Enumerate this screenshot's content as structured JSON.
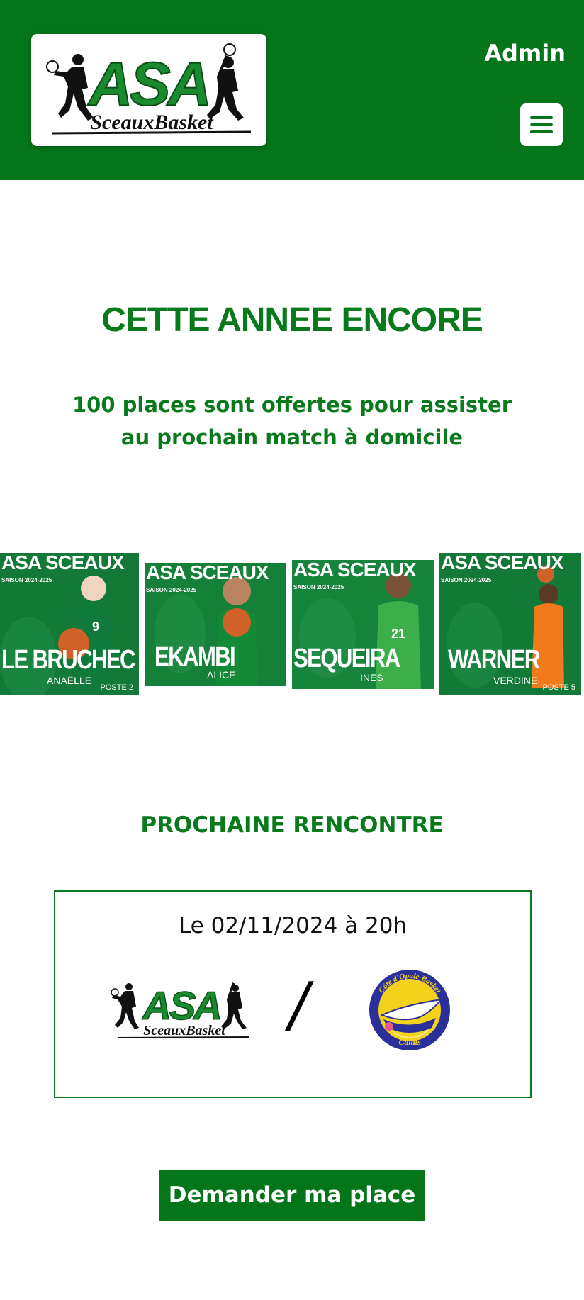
{
  "header": {
    "logo": {
      "top_text": "ASA",
      "bottom_text": "SceauxBasket"
    },
    "admin_label": "Admin",
    "menu_icon": "hamburger-icon"
  },
  "hero": {
    "headline": "CETTE ANNEE ENCORE",
    "subline": "100 places sont offertes pour assister au prochain match à domicile"
  },
  "carousel": {
    "club_text": "ASA SCEAUX",
    "season_text": "SAISON 2024-2025",
    "players": [
      {
        "name": "LE BRUCHEC",
        "first_name": "ANAËLLE",
        "position": "POSTE 2",
        "number": "9",
        "jersey_color": "#0f7a3a",
        "skin": "#f0d4c0"
      },
      {
        "name": "EKAMBI",
        "first_name": "ALICE",
        "position": "",
        "number": "",
        "jersey_color": "#138a36",
        "skin": "#b98560"
      },
      {
        "name": "SEQUEIRA",
        "first_name": "INÈS",
        "position": "",
        "number": "21",
        "jersey_color": "#3cae4a",
        "skin": "#7a5238"
      },
      {
        "name": "WARNER",
        "first_name": "VERDINE",
        "position": "POSTE 5",
        "number": "",
        "jersey_color": "#f07a1c",
        "skin": "#5a3a28"
      }
    ]
  },
  "next_match": {
    "title": "PROCHAINE RENCONTRE",
    "date_text": "Le 02/11/2024 à 20h",
    "separator": "/",
    "home_logo": {
      "top_text": "ASA",
      "bottom_text": "SceauxBasket"
    },
    "away_logo": {
      "ring_text": "Côte d'Opale Basket",
      "bottom_text": "Calais",
      "inner_text": "Transmettre nos frontières"
    }
  },
  "cta": {
    "label": "Demander ma place"
  },
  "colors": {
    "brand_green": "#057519",
    "title_green": "#087a1c",
    "white": "#ffffff",
    "away_blue": "#2a2f9a",
    "away_yellow": "#f4d21c"
  }
}
